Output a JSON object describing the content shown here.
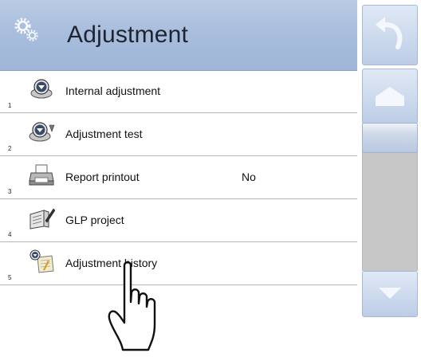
{
  "title": "Adjustment",
  "items": [
    {
      "num": "1",
      "label": "Internal adjustment",
      "value": "",
      "icon": "adjustment-weight-icon"
    },
    {
      "num": "2",
      "label": "Adjustment test",
      "value": "",
      "icon": "adjustment-test-icon"
    },
    {
      "num": "3",
      "label": "Report printout",
      "value": "No",
      "icon": "printer-icon"
    },
    {
      "num": "4",
      "label": "GLP project",
      "value": "",
      "icon": "glp-project-icon"
    },
    {
      "num": "5",
      "label": "Adjustment history",
      "value": "",
      "icon": "adjustment-history-icon"
    }
  ],
  "sidebar": {
    "buttons": [
      "back-icon",
      "home-icon",
      "scroll-down-icon"
    ]
  },
  "colors": {
    "titlebar": "#a9bedd",
    "scroll_track": "#c7c7c7",
    "button_blue": "#bccde6"
  }
}
